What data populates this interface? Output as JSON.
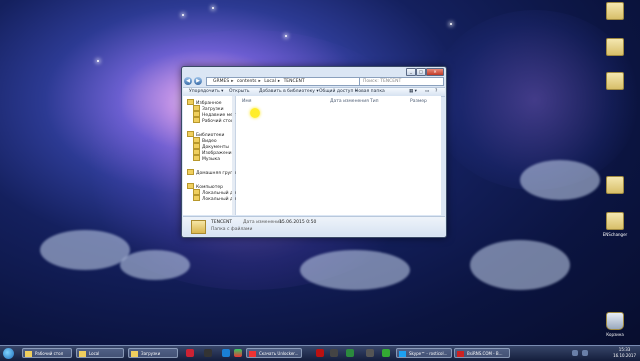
{
  "desktop": {
    "icons_right": [
      {
        "label": "",
        "icon": "folder-icon"
      },
      {
        "label": "",
        "icon": "folder-icon"
      },
      {
        "label": "",
        "icon": "folder-icon"
      },
      {
        "label": "",
        "icon": "folder-icon"
      },
      {
        "label": "ENSchanger",
        "icon": "folder-icon"
      },
      {
        "label": "Корзина",
        "icon": "recycle-bin-icon"
      }
    ]
  },
  "explorer": {
    "breadcrumb": [
      "GRMES",
      "contents",
      "Local",
      "TENCENT"
    ],
    "search_placeholder": "Поиск: TENCENT",
    "toolbar": {
      "organize": "Упорядочить ▾",
      "open": "Открыть",
      "add_to_library": "Добавить в библиотеку ▾",
      "share": "Общий доступ ▾",
      "new_folder": "Новая папка"
    },
    "nav": {
      "favorites": "Избранное",
      "downloads": "Загрузки",
      "recent": "Недавние места",
      "desktop": "Рабочий стол",
      "libraries": "Библиотеки",
      "video": "Видео",
      "documents": "Документы",
      "images": "Изображения",
      "music": "Музыка",
      "homegroup": "Домашняя группа",
      "computer": "Компьютер",
      "local_disk_c": "Локальный диск",
      "local_disk_d": "Локальный диск"
    },
    "columns": {
      "name": "Имя",
      "date": "Дата изменения",
      "type": "Тип",
      "size": "Размер"
    },
    "details": {
      "name": "TENCENT",
      "date_label": "Дата изменения:",
      "date_value": "15.06.2015 0:50",
      "type": "Папка с файлами"
    }
  },
  "taskbar": {
    "items": [
      {
        "label": "Рабочий стол"
      },
      {
        "label": "Local"
      },
      {
        "label": "Загрузки"
      },
      {
        "label": "Скачать Unlocker..."
      },
      {
        "label": "Skype™ - rosticol..."
      },
      {
        "label": "BsiRNS.COM - B..."
      }
    ],
    "clock_time": "15:33",
    "clock_date": "16.10.2017"
  }
}
